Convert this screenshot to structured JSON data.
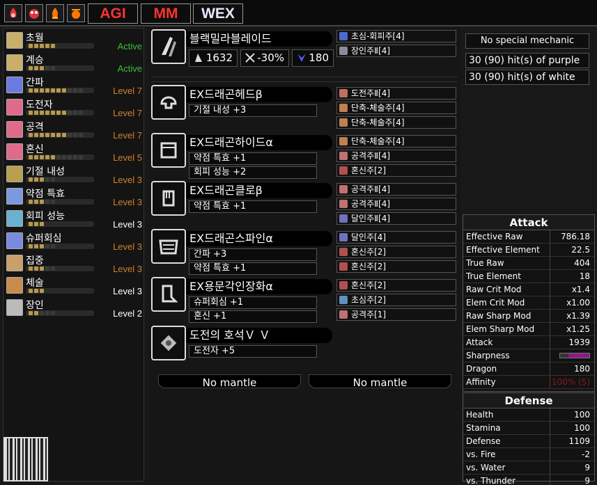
{
  "topbar": {
    "buttons": [
      "AGI",
      "MM",
      "WEX"
    ],
    "icons": [
      "fire-element-icon",
      "slime-icon",
      "fire-icon",
      "bomb-icon"
    ]
  },
  "skills": [
    {
      "name": "초월",
      "level": "Active",
      "level_color": "#3bbf3b",
      "filled": 5,
      "total": 5
    },
    {
      "name": "계승",
      "level": "Active",
      "level_color": "#3bbf3b",
      "filled": 3,
      "total": 5
    },
    {
      "name": "간파",
      "level": "Level 7",
      "level_color": "#d08030",
      "filled": 7,
      "total": 10
    },
    {
      "name": "도전자",
      "level": "Level 7",
      "level_color": "#d08030",
      "filled": 7,
      "total": 10
    },
    {
      "name": "공격",
      "level": "Level 7",
      "level_color": "#d08030",
      "filled": 7,
      "total": 10
    },
    {
      "name": "혼신",
      "level": "Level 5",
      "level_color": "#d08030",
      "filled": 5,
      "total": 10
    },
    {
      "name": "기절 내성",
      "level": "Level 3",
      "level_color": "#d08030",
      "filled": 3,
      "total": 5
    },
    {
      "name": "약점 특효",
      "level": "Level 3",
      "level_color": "#d08030",
      "filled": 3,
      "total": 5
    },
    {
      "name": "회피 성능",
      "level": "Level 3",
      "level_color": "#ffffff",
      "filled": 3,
      "total": 3
    },
    {
      "name": "슈퍼회심",
      "level": "Level 3",
      "level_color": "#d08030",
      "filled": 3,
      "total": 5
    },
    {
      "name": "집중",
      "level": "Level 3",
      "level_color": "#d08030",
      "filled": 3,
      "total": 5
    },
    {
      "name": "체술",
      "level": "Level 3",
      "level_color": "#ffffff",
      "filled": 3,
      "total": 3
    },
    {
      "name": "장인",
      "level": "Level 2",
      "level_color": "#ffffff",
      "filled": 2,
      "total": 5
    }
  ],
  "weapon": {
    "name": "블랙밀라블레이드",
    "attack": "1632",
    "affinity": "-30%",
    "element": "180",
    "decos": [
      "초심-회피주[4]",
      "장인주Ⅱ[4]"
    ]
  },
  "armor": [
    {
      "name": "EX드래곤헤드β",
      "skills": [
        "기절 내성 +3"
      ],
      "decos": [
        "도전주Ⅱ[4]",
        "단축-체술주[4]",
        "단축-체술주[4]"
      ],
      "icon": "helmet-icon"
    },
    {
      "name": "EX드래곤하이드α",
      "skills": [
        "약점 특효 +1",
        "회피 성능 +2"
      ],
      "decos": [
        "단축-체술주[4]",
        "공격주Ⅱ[4]",
        "혼신주[2]"
      ],
      "icon": "chest-armor-icon"
    },
    {
      "name": "EX드래곤클로β",
      "skills": [
        "약점 특효 +1"
      ],
      "decos": [
        "공격주Ⅱ[4]",
        "공격주Ⅱ[4]",
        "달인주Ⅱ[4]"
      ],
      "icon": "gauntlet-icon"
    },
    {
      "name": "EX드래곤스파인α",
      "skills": [
        "간파 +3",
        "약점 특효 +1"
      ],
      "decos": [
        "달인주[4]",
        "혼신주[2]",
        "혼신주[2]"
      ],
      "icon": "waist-armor-icon"
    },
    {
      "name": "EX용문각인장화α",
      "skills": [
        "슈퍼회심 +1",
        "혼신 +1"
      ],
      "decos": [
        "혼신주[2]",
        "초심주[2]",
        "공격주[1]"
      ],
      "icon": "greaves-icon"
    }
  ],
  "charm": {
    "name": "도전의 호석Ｖ Ｖ",
    "skills": [
      "도전자 +5"
    ]
  },
  "mantles": [
    "No mantle",
    "No mantle"
  ],
  "info": {
    "special": "No special mechanic",
    "purple": "30 (90) hit(s) of purple",
    "white": "30 (90) hit(s) of white"
  },
  "attack": {
    "title": "Attack",
    "rows": [
      {
        "k": "Effective Raw",
        "v": "786.18"
      },
      {
        "k": "Effective Element",
        "v": "22.5"
      },
      {
        "k": "True Raw",
        "v": "404"
      },
      {
        "k": "True Element",
        "v": "18"
      },
      {
        "k": "Raw Crit Mod",
        "v": "x1.4"
      },
      {
        "k": "Elem Crit Mod",
        "v": "x1.00"
      },
      {
        "k": "Raw Sharp Mod",
        "v": "x1.39"
      },
      {
        "k": "Elem Sharp Mod",
        "v": "x1.25"
      },
      {
        "k": "Attack",
        "v": "1939"
      },
      {
        "k": "Sharpness",
        "v": ""
      },
      {
        "k": "Dragon",
        "v": "180"
      },
      {
        "k": "Affinity",
        "v": "100% (5)"
      }
    ]
  },
  "defense": {
    "title": "Defense",
    "rows": [
      {
        "k": "Health",
        "v": "100"
      },
      {
        "k": "Stamina",
        "v": "100"
      },
      {
        "k": "Defense",
        "v": "1109"
      },
      {
        "k": "vs. Fire",
        "v": "-2"
      },
      {
        "k": "vs. Water",
        "v": "9"
      },
      {
        "k": "vs. Thunder",
        "v": "9"
      }
    ]
  },
  "colors": {
    "active": "#3bbf3b",
    "level": "#d08030",
    "affinity": "#8a1a1a",
    "sharpness": "#8a1a8a"
  }
}
